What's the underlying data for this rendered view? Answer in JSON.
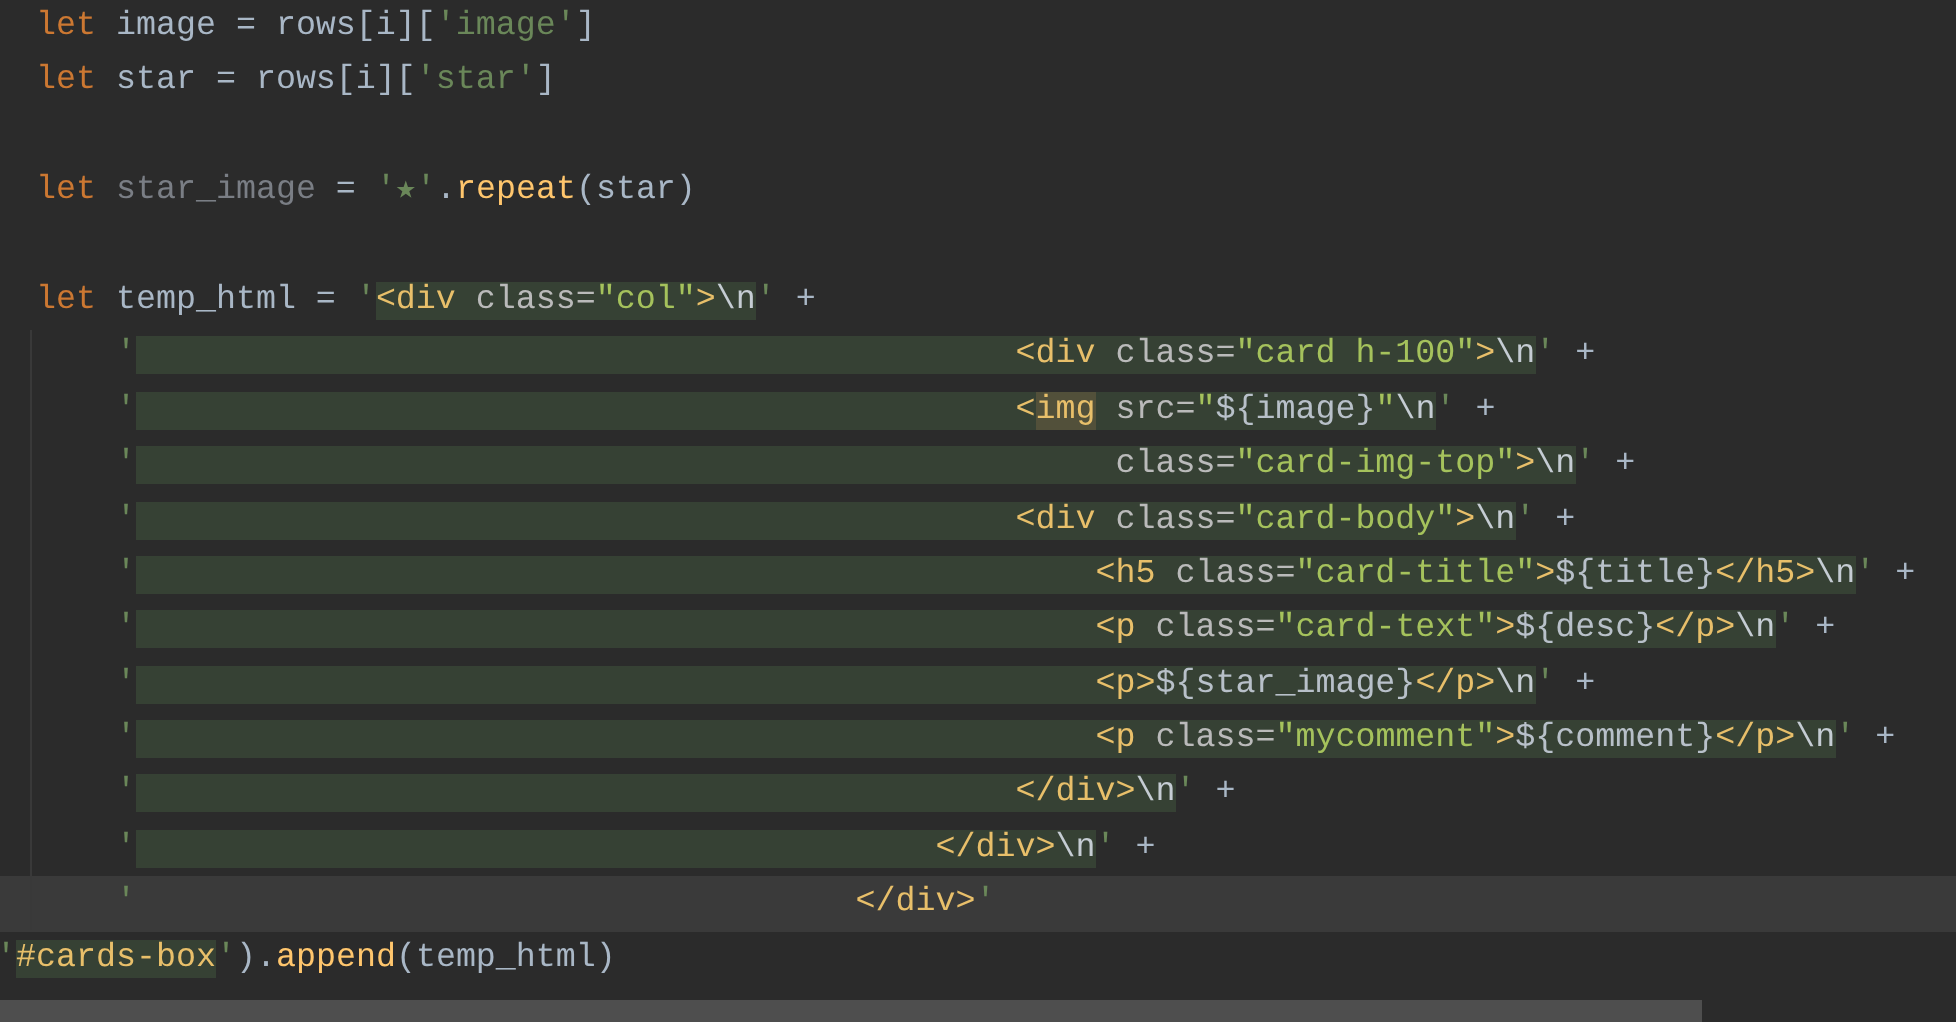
{
  "editor": {
    "blocks": [
      [
        {
          "segments": [
            {
              "text": "  let",
              "kind": "keyword",
              "injected": false
            },
            {
              "text": " image = rows[i][",
              "kind": "plain",
              "injected": false
            },
            {
              "text": "'image'",
              "kind": "string",
              "injected": false
            },
            {
              "text": "]",
              "kind": "plain",
              "injected": false
            }
          ]
        },
        {
          "segments": [
            {
              "text": "  let",
              "kind": "keyword",
              "injected": false
            },
            {
              "text": " star = rows[i][",
              "kind": "plain",
              "injected": false
            },
            {
              "text": "'star'",
              "kind": "string",
              "injected": false
            },
            {
              "text": "]",
              "kind": "plain",
              "injected": false
            }
          ]
        }
      ],
      [
        {
          "segments": [
            {
              "text": "  let",
              "kind": "keyword",
              "injected": false
            },
            {
              "text": " star_image",
              "kind": "unused",
              "injected": false
            },
            {
              "text": " = ",
              "kind": "plain",
              "injected": false
            },
            {
              "text": "'★'",
              "kind": "string",
              "injected": false
            },
            {
              "text": ".",
              "kind": "plain",
              "injected": false
            },
            {
              "text": "repeat",
              "kind": "function",
              "injected": false
            },
            {
              "text": "(star)",
              "kind": "plain",
              "injected": false
            }
          ]
        }
      ],
      [
        {
          "segments": [
            {
              "text": "  let",
              "kind": "keyword",
              "injected": false
            },
            {
              "text": " temp_html = ",
              "kind": "plain",
              "injected": false
            },
            {
              "text": "'",
              "kind": "string",
              "injected": false
            },
            {
              "text": "<div",
              "kind": "tag",
              "injected": true
            },
            {
              "text": " class=",
              "kind": "attribute",
              "injected": true
            },
            {
              "text": "\"col\"",
              "kind": "value",
              "injected": true
            },
            {
              "text": ">",
              "kind": "tag",
              "injected": true
            },
            {
              "text": "\\n",
              "kind": "escape",
              "injected": true
            },
            {
              "text": "'",
              "kind": "string",
              "injected": false
            },
            {
              "text": " +",
              "kind": "plain",
              "injected": false
            }
          ]
        },
        {
          "segments": [
            {
              "text": "      '",
              "kind": "string",
              "injected": false
            },
            {
              "text": "                                            <div",
              "kind": "tag",
              "injected": true
            },
            {
              "text": " class=",
              "kind": "attribute",
              "injected": true
            },
            {
              "text": "\"card h-100\"",
              "kind": "value",
              "injected": true
            },
            {
              "text": ">",
              "kind": "tag",
              "injected": true
            },
            {
              "text": "\\n",
              "kind": "escape",
              "injected": true
            },
            {
              "text": "'",
              "kind": "string",
              "injected": false
            },
            {
              "text": " +",
              "kind": "plain",
              "injected": false
            }
          ]
        },
        {
          "segments": [
            {
              "text": "      '",
              "kind": "string",
              "injected": false
            },
            {
              "text": "                                            <",
              "kind": "tag",
              "injected": true
            },
            {
              "text": "img",
              "kind": "tag_match"
            },
            {
              "text": " src=",
              "kind": "attribute",
              "injected": true
            },
            {
              "text": "\"",
              "kind": "value",
              "injected": true
            },
            {
              "text": "${image}",
              "kind": "interpolation",
              "injected": true
            },
            {
              "text": "\"",
              "kind": "value",
              "injected": true
            },
            {
              "text": "\\n",
              "kind": "escape",
              "injected": true
            },
            {
              "text": "'",
              "kind": "string",
              "injected": false
            },
            {
              "text": " +",
              "kind": "plain",
              "injected": false
            }
          ]
        },
        {
          "segments": [
            {
              "text": "      '",
              "kind": "string",
              "injected": false
            },
            {
              "text": "                                                 class=",
              "kind": "attribute",
              "injected": true
            },
            {
              "text": "\"card-img-top\"",
              "kind": "value",
              "injected": true
            },
            {
              "text": ">",
              "kind": "tag",
              "injected": true
            },
            {
              "text": "\\n",
              "kind": "escape",
              "injected": true
            },
            {
              "text": "'",
              "kind": "string",
              "injected": false
            },
            {
              "text": " +",
              "kind": "plain",
              "injected": false
            }
          ]
        },
        {
          "segments": [
            {
              "text": "      '",
              "kind": "string",
              "injected": false
            },
            {
              "text": "                                            <div",
              "kind": "tag",
              "injected": true
            },
            {
              "text": " class=",
              "kind": "attribute",
              "injected": true
            },
            {
              "text": "\"card-body\"",
              "kind": "value",
              "injected": true
            },
            {
              "text": ">",
              "kind": "tag",
              "injected": true
            },
            {
              "text": "\\n",
              "kind": "escape",
              "injected": true
            },
            {
              "text": "'",
              "kind": "string",
              "injected": false
            },
            {
              "text": " +",
              "kind": "plain",
              "injected": false
            }
          ]
        },
        {
          "segments": [
            {
              "text": "      '",
              "kind": "string",
              "injected": false
            },
            {
              "text": "                                                <h5",
              "kind": "tag",
              "injected": true
            },
            {
              "text": " class=",
              "kind": "attribute",
              "injected": true
            },
            {
              "text": "\"card-title\"",
              "kind": "value",
              "injected": true
            },
            {
              "text": ">",
              "kind": "tag",
              "injected": true
            },
            {
              "text": "${title}",
              "kind": "interpolation",
              "injected": true
            },
            {
              "text": "</h5>",
              "kind": "tag",
              "injected": true
            },
            {
              "text": "\\n",
              "kind": "escape",
              "injected": true
            },
            {
              "text": "'",
              "kind": "string",
              "injected": false
            },
            {
              "text": " +",
              "kind": "plain",
              "injected": false
            }
          ]
        },
        {
          "segments": [
            {
              "text": "      '",
              "kind": "string",
              "injected": false
            },
            {
              "text": "                                                <p",
              "kind": "tag",
              "injected": true
            },
            {
              "text": " class=",
              "kind": "attribute",
              "injected": true
            },
            {
              "text": "\"card-text\"",
              "kind": "value",
              "injected": true
            },
            {
              "text": ">",
              "kind": "tag",
              "injected": true
            },
            {
              "text": "${desc}",
              "kind": "interpolation",
              "injected": true
            },
            {
              "text": "</p>",
              "kind": "tag",
              "injected": true
            },
            {
              "text": "\\n",
              "kind": "escape",
              "injected": true
            },
            {
              "text": "'",
              "kind": "string",
              "injected": false
            },
            {
              "text": " +",
              "kind": "plain",
              "injected": false
            }
          ]
        },
        {
          "segments": [
            {
              "text": "      '",
              "kind": "string",
              "injected": false
            },
            {
              "text": "                                                <p>",
              "kind": "tag",
              "injected": true
            },
            {
              "text": "${star_image}",
              "kind": "interpolation",
              "injected": true
            },
            {
              "text": "</p>",
              "kind": "tag",
              "injected": true
            },
            {
              "text": "\\n",
              "kind": "escape",
              "injected": true
            },
            {
              "text": "'",
              "kind": "string",
              "injected": false
            },
            {
              "text": " +",
              "kind": "plain",
              "injected": false
            }
          ]
        },
        {
          "segments": [
            {
              "text": "      '",
              "kind": "string",
              "injected": false
            },
            {
              "text": "                                                <p",
              "kind": "tag",
              "injected": true
            },
            {
              "text": " class=",
              "kind": "attribute",
              "injected": true
            },
            {
              "text": "\"mycomment\"",
              "kind": "value",
              "injected": true
            },
            {
              "text": ">",
              "kind": "tag",
              "injected": true
            },
            {
              "text": "${comment}",
              "kind": "interpolation",
              "injected": true
            },
            {
              "text": "</p>",
              "kind": "tag",
              "injected": true
            },
            {
              "text": "\\n",
              "kind": "escape",
              "injected": true
            },
            {
              "text": "'",
              "kind": "string",
              "injected": false
            },
            {
              "text": " +",
              "kind": "plain",
              "injected": false
            }
          ]
        },
        {
          "segments": [
            {
              "text": "      '",
              "kind": "string",
              "injected": false
            },
            {
              "text": "                                            </div>",
              "kind": "tag",
              "injected": true
            },
            {
              "text": "\\n",
              "kind": "escape",
              "injected": true
            },
            {
              "text": "'",
              "kind": "string",
              "injected": false
            },
            {
              "text": " +",
              "kind": "plain",
              "injected": false
            }
          ]
        },
        {
          "segments": [
            {
              "text": "      '",
              "kind": "string",
              "injected": false
            },
            {
              "text": "                                        </div>",
              "kind": "tag",
              "injected": true
            },
            {
              "text": "\\n",
              "kind": "escape",
              "injected": true
            },
            {
              "text": "'",
              "kind": "string",
              "injected": false
            },
            {
              "text": " +",
              "kind": "plain",
              "injected": false
            }
          ]
        },
        {
          "current": true,
          "segments": [
            {
              "text": "      '",
              "kind": "string"
            },
            {
              "text": "                                    </div>",
              "kind": "tag"
            },
            {
              "text": "'",
              "kind": "string"
            }
          ]
        },
        {
          "segments": [
            {
              "text": "'",
              "kind": "string",
              "injected": false
            },
            {
              "text": "#cards-box",
              "kind": "selector",
              "injected": true
            },
            {
              "text": "'",
              "kind": "string",
              "injected": false
            },
            {
              "text": ").",
              "kind": "plain",
              "injected": false
            },
            {
              "text": "append",
              "kind": "function",
              "injected": false
            },
            {
              "text": "(temp_html)",
              "kind": "plain",
              "injected": false
            }
          ]
        }
      ]
    ]
  }
}
